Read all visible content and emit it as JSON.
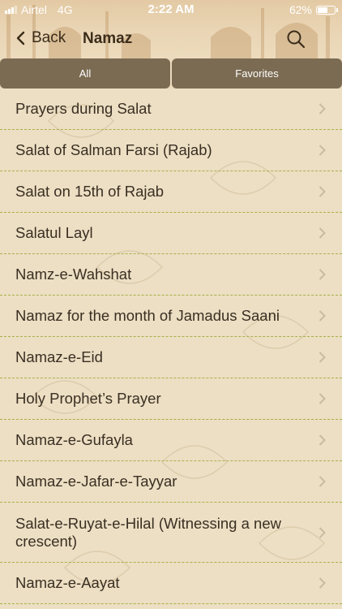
{
  "status_bar": {
    "carrier": "Airtel",
    "network": "4G",
    "time": "2:22 AM",
    "battery": "62%",
    "battery_level": 0.62
  },
  "nav": {
    "back_label": "Back",
    "title": "Namaz"
  },
  "segments": [
    {
      "label": "All",
      "selected": true
    },
    {
      "label": "Favorites",
      "selected": false
    }
  ],
  "items": [
    {
      "label": "Prayers during Salat"
    },
    {
      "label": "Salat of Salman Farsi (Rajab)"
    },
    {
      "label": "Salat on 15th of Rajab"
    },
    {
      "label": "Salatul Layl"
    },
    {
      "label": "Namz-e-Wahshat"
    },
    {
      "label": "Namaz for the month of Jamadus Saani"
    },
    {
      "label": "Namaz-e-Eid"
    },
    {
      "label": "Holy Prophet’s Prayer"
    },
    {
      "label": "Namaz-e-Gufayla"
    },
    {
      "label": "Namaz-e-Jafar-e-Tayyar"
    },
    {
      "label": "Salat-e-Ruyat-e-Hilal (Witnessing a new crescent)"
    },
    {
      "label": "Namaz-e-Aayat"
    }
  ],
  "colors": {
    "background": "#ecdfc4",
    "segment": "#7b6b52",
    "divider": "#a9b04a",
    "text": "#3a2f22"
  }
}
